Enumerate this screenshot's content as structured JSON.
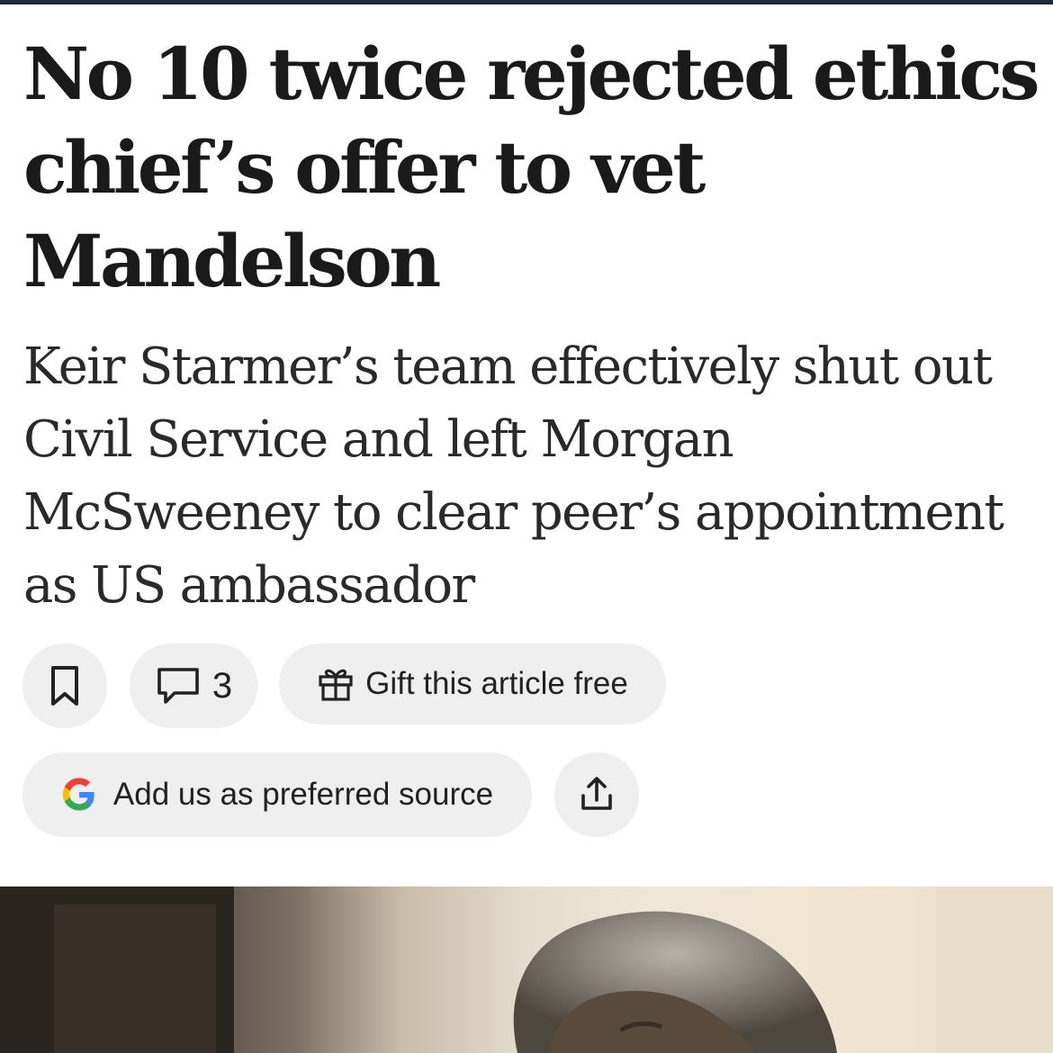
{
  "article": {
    "headline": "No 10 twice rejected ethics chief’s offer to vet Mandelson",
    "standfirst": "Keir Starmer’s team effectively shut out Civil Service and left Morgan McSweeney to clear peer’s appointment as US ambassador"
  },
  "actions": {
    "bookmark_icon": "bookmark-icon",
    "comment_icon": "comment-icon",
    "comment_count": "3",
    "gift_icon": "gift-icon",
    "gift_label": "Gift this article free",
    "source_icon": "google-g-icon",
    "source_label": "Add us as preferred source",
    "share_icon": "share-icon"
  },
  "colors": {
    "top_bar": "#1f2b36",
    "pill_background": "#efefef",
    "text": "#1a1a1a"
  }
}
